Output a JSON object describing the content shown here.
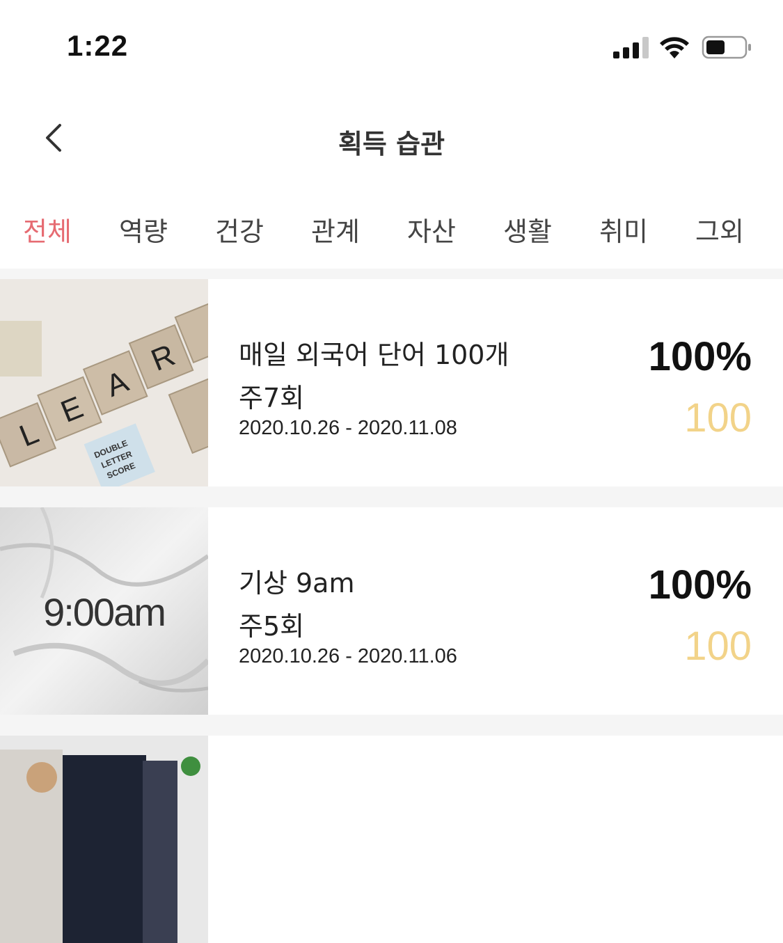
{
  "status_bar": {
    "time": "1:22"
  },
  "nav": {
    "title": "획득 습관"
  },
  "tabs": [
    {
      "label": "전체",
      "active": true
    },
    {
      "label": "역량",
      "active": false
    },
    {
      "label": "건강",
      "active": false
    },
    {
      "label": "관계",
      "active": false
    },
    {
      "label": "자산",
      "active": false
    },
    {
      "label": "생활",
      "active": false
    },
    {
      "label": "취미",
      "active": false
    },
    {
      "label": "그외",
      "active": false
    }
  ],
  "habits": [
    {
      "title": "매일 외국어 단어 100개",
      "frequency": "주7회",
      "dates": "2020.10.26 - 2020.11.08",
      "percent": "100%",
      "score": "100",
      "image": "scrabble-learn-photo",
      "image_text": "DOUBLE LETTER SCORE"
    },
    {
      "title": "기상 9am",
      "frequency": "주5회",
      "dates": "2020.10.26 - 2020.11.06",
      "percent": "100%",
      "score": "100",
      "image": "bedsheet-photo",
      "image_text": "9:00am"
    },
    {
      "image": "books-photo"
    }
  ],
  "colors": {
    "active_tab": "#e66b72",
    "score": "#f2d389",
    "separator": "#f5f5f5"
  }
}
